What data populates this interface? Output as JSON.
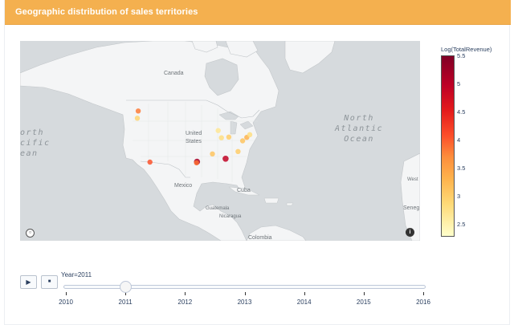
{
  "header": {
    "title": "Geographic distribution of sales territories"
  },
  "map": {
    "labels": {
      "canada": "Canada",
      "united_states": "United\nStates",
      "mexico": "Mexico",
      "cuba": "Cuba",
      "guatemala": "Guatemala",
      "nicaragua": "Nicaragua",
      "colombia": "Colombia",
      "west": "West",
      "seneg": "Seneg"
    },
    "ocean_labels": {
      "north_atlantic": "North\nAtlantic\nOcean",
      "north_pacific": "orth\ncific\nean"
    },
    "controls": {
      "zoom_icon": "magnifier-icon",
      "info_icon": "info-icon",
      "info_glyph": "i"
    }
  },
  "chart_data": {
    "type": "scatter",
    "title": "Geographic distribution of sales territories",
    "colorbar": {
      "title": "Log(TotalRevenue)",
      "range": [
        2.3,
        5.5
      ],
      "ticks": [
        "5.5",
        "5",
        "4.5",
        "4",
        "3.5",
        "3",
        "2.5"
      ]
    },
    "colors": {
      "high": "#800026",
      "mid": "#fd8d3c",
      "low": "#ffffcc"
    },
    "points": [
      {
        "lon": -122.3,
        "lat": 47.6,
        "value": 3.8
      },
      {
        "lon": -122.7,
        "lat": 45.5,
        "value": 2.8
      },
      {
        "lon": -117.2,
        "lat": 32.7,
        "value": 4.1
      },
      {
        "lon": -96.8,
        "lat": 32.8,
        "value": 5.2
      },
      {
        "lon": -97.0,
        "lat": 32.5,
        "value": 3.9
      },
      {
        "lon": -90.1,
        "lat": 35.1,
        "value": 3.0
      },
      {
        "lon": -87.6,
        "lat": 41.9,
        "value": 2.6
      },
      {
        "lon": -86.2,
        "lat": 39.8,
        "value": 2.7
      },
      {
        "lon": -83.0,
        "lat": 40.0,
        "value": 2.9
      },
      {
        "lon": -84.4,
        "lat": 33.7,
        "value": 5.0
      },
      {
        "lon": -79.0,
        "lat": 35.8,
        "value": 2.9
      },
      {
        "lon": -77.0,
        "lat": 38.9,
        "value": 3.0
      },
      {
        "lon": -75.2,
        "lat": 39.9,
        "value": 3.2
      },
      {
        "lon": -73.9,
        "lat": 40.7,
        "value": 2.7
      }
    ]
  },
  "slider": {
    "current_label": "Year=2011",
    "current_value": 2011,
    "years": [
      "2010",
      "2011",
      "2012",
      "2013",
      "2014",
      "2015",
      "2016"
    ],
    "play_glyph": "▶",
    "stop_glyph": "■"
  }
}
